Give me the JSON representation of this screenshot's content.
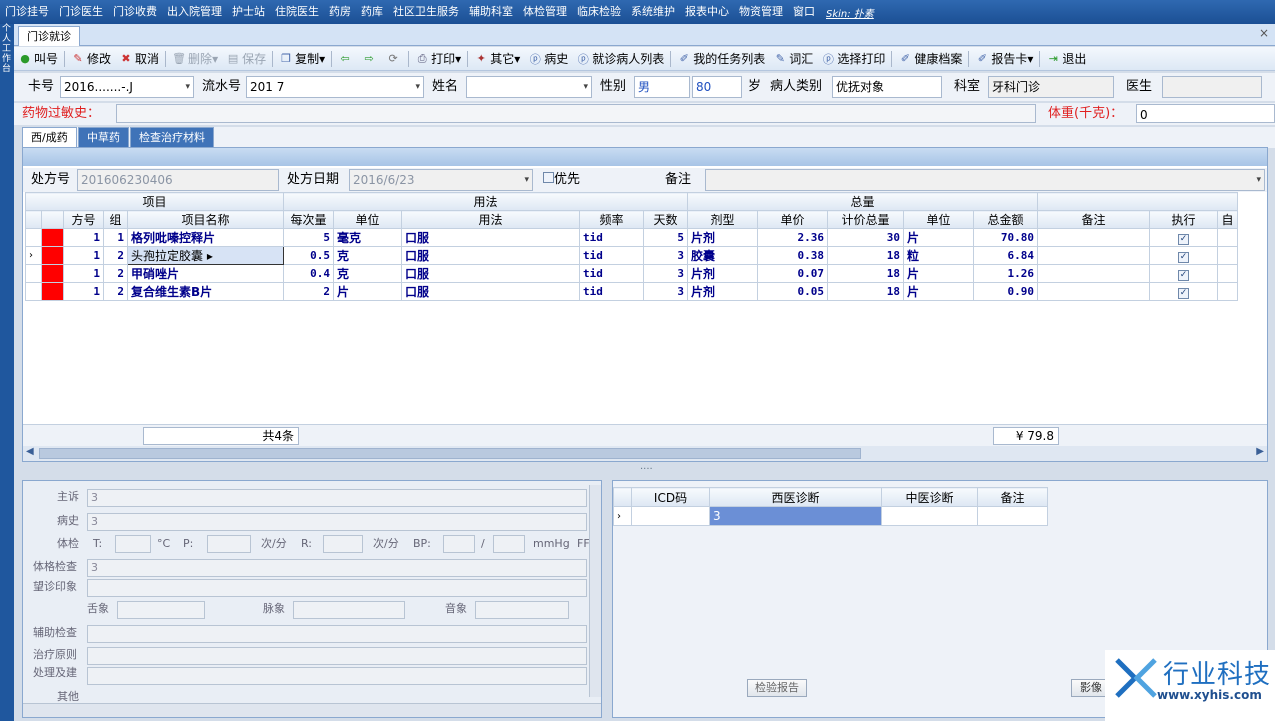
{
  "menu": [
    "门诊挂号",
    "门诊医生",
    "门诊收费",
    "出入院管理",
    "护士站",
    "住院医生",
    "药房",
    "药库",
    "社区卫生服务",
    "辅助科室",
    "体检管理",
    "临床检验",
    "系统维护",
    "报表中心",
    "物资管理",
    "窗口"
  ],
  "skin": "Skin: 扑素",
  "left_strip": [
    "个",
    "人",
    "工",
    "作",
    "台"
  ],
  "tab": {
    "label": "门诊就诊"
  },
  "toolbar": {
    "call": "叫号",
    "edit": "修改",
    "cancel": "取消",
    "delete": "删除",
    "save": "保存",
    "copy": "复制",
    "print": "打印",
    "other": "其它",
    "history": "病史",
    "visit_list": "就诊病人列表",
    "tasks": "我的任务列表",
    "vocab": "词汇",
    "select_print": "选择打印",
    "health": "健康档案",
    "report_card": "报告卡",
    "exit": "退出"
  },
  "patient": {
    "card_label": "卡号",
    "card": "2016.......-.J",
    "serial_label": "流水号",
    "serial": "201          7",
    "name_label": "姓名",
    "name": "",
    "sex_label": "性别",
    "sex": "男",
    "age": "80",
    "age_unit": "岁",
    "type_label": "病人类别",
    "type": "优抚对象",
    "dept_label": "科室",
    "dept": "牙科门诊",
    "doctor_label": "医生",
    "doctor": ""
  },
  "allergy": {
    "label": "药物过敏史：",
    "weight_label": "体重(千克)：",
    "weight": "0"
  },
  "rxtabs": [
    "西/成药",
    "中草药",
    "检查治疗材料"
  ],
  "rx": {
    "no_label": "处方号",
    "no": "201606230406",
    "date_label": "处方日期",
    "date": "2016/6/23",
    "priority": "优先",
    "note_label": "备注"
  },
  "grid": {
    "groups": {
      "item": "项目",
      "usage": "用法",
      "total": "总量"
    },
    "cols": [
      "方号",
      "组",
      "项目名称",
      "每次量",
      "单位",
      "用法",
      "频率",
      "天数",
      "剂型",
      "单价",
      "计价总量",
      "单位",
      "总金额",
      "备注",
      "执行",
      "自"
    ],
    "rows": [
      {
        "fh": "1",
        "zu": "1",
        "name": "格列吡嗪控释片",
        "dose": "5",
        "unit": "毫克",
        "usage": "口服",
        "freq": "tid",
        "days": "5",
        "form": "片剂",
        "price": "2.36",
        "qty": "30",
        "qunit": "片",
        "amount": "70.80"
      },
      {
        "fh": "1",
        "zu": "2",
        "name": "头孢拉定胶囊",
        "dose": "0.5",
        "unit": "克",
        "usage": "口服",
        "freq": "tid",
        "days": "3",
        "form": "胶囊",
        "price": "0.38",
        "qty": "18",
        "qunit": "粒",
        "amount": "6.84"
      },
      {
        "fh": "1",
        "zu": "2",
        "name": "甲硝唑片",
        "dose": "0.4",
        "unit": "克",
        "usage": "口服",
        "freq": "tid",
        "days": "3",
        "form": "片剂",
        "price": "0.07",
        "qty": "18",
        "qunit": "片",
        "amount": "1.26"
      },
      {
        "fh": "1",
        "zu": "2",
        "name": "复合维生素B片",
        "dose": "2",
        "unit": "片",
        "usage": "口服",
        "freq": "tid",
        "days": "3",
        "form": "片剂",
        "price": "0.05",
        "qty": "18",
        "qunit": "片",
        "amount": "0.90"
      }
    ],
    "count": "共4条",
    "total": "¥ 79.8"
  },
  "exam": {
    "chief": "主诉",
    "chief_v": "3",
    "history": "病史",
    "history_v": "3",
    "vitals": "体检",
    "t": "T:",
    "t_u": "°C",
    "p": "P:",
    "p_u": "次/分",
    "r": "R:",
    "r_u": "次/分",
    "bp": "BP:",
    "bp_sep": "/",
    "bp_u": "mmHg",
    "fp": "FF",
    "phys": "体格检查",
    "phys_v": "3",
    "inspect": "望诊印象",
    "tongue": "舌象",
    "pulse": "脉象",
    "voice": "音象",
    "aux": "辅助检查",
    "principle": "治疗原则",
    "treat": "处理及建",
    "other": "其他"
  },
  "diag": {
    "cols": [
      "ICD码",
      "西医诊断",
      "中医诊断",
      "备注"
    ],
    "row": {
      "icd": "",
      "west": "3",
      "chinese": "",
      "note": ""
    },
    "btn_report": "检验报告",
    "btn_image": "影像"
  },
  "logo": {
    "name": "行业科技",
    "url": "www.xyhis.com"
  }
}
